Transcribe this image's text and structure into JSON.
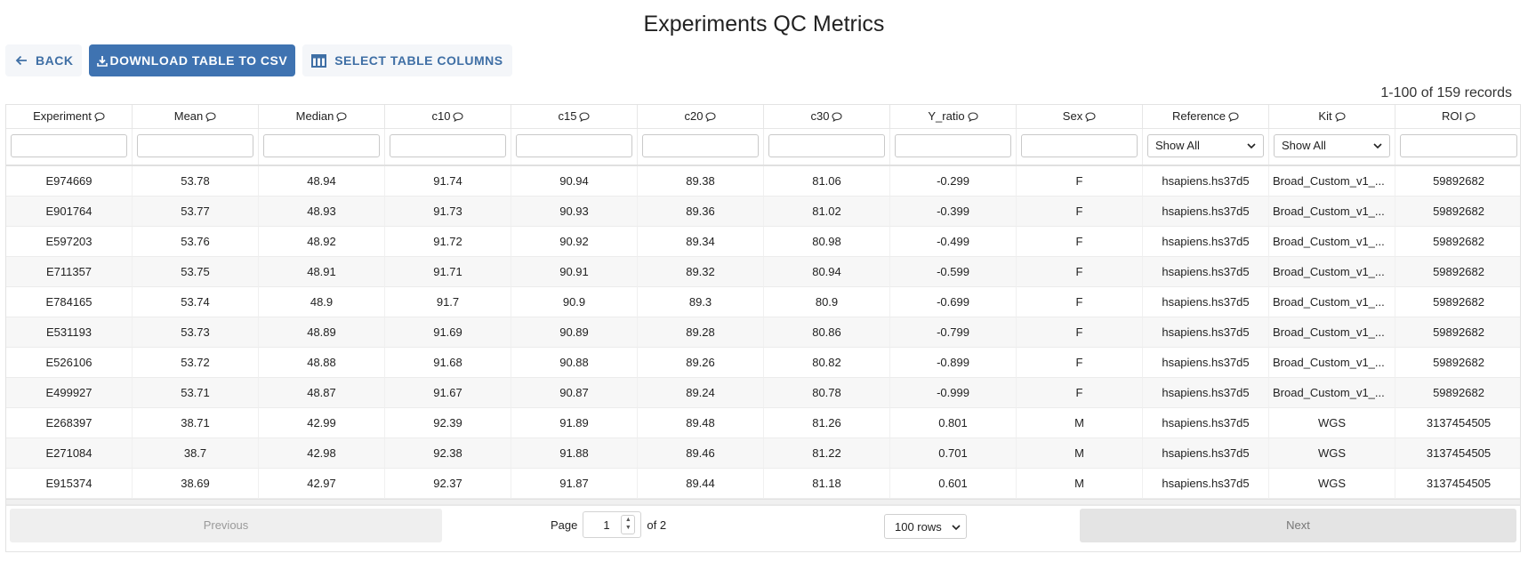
{
  "page": {
    "title": "Experiments QC Metrics"
  },
  "toolbar": {
    "back_label": "BACK",
    "download_label": "DOWNLOAD TABLE TO CSV",
    "columns_label": "SELECT TABLE COLUMNS"
  },
  "records_summary": "1-100 of 159 records",
  "table": {
    "headers": [
      "Experiment",
      "Mean",
      "Median",
      "c10",
      "c15",
      "c20",
      "c30",
      "Y_ratio",
      "Sex",
      "Reference",
      "Kit",
      "ROI"
    ],
    "filters": {
      "reference": "Show All",
      "kit": "Show All"
    },
    "rows": [
      [
        "E974669",
        "53.78",
        "48.94",
        "91.74",
        "90.94",
        "89.38",
        "81.06",
        "-0.299",
        "F",
        "hsapiens.hs37d5",
        "Broad_Custom_v1_...",
        "59892682"
      ],
      [
        "E901764",
        "53.77",
        "48.93",
        "91.73",
        "90.93",
        "89.36",
        "81.02",
        "-0.399",
        "F",
        "hsapiens.hs37d5",
        "Broad_Custom_v1_...",
        "59892682"
      ],
      [
        "E597203",
        "53.76",
        "48.92",
        "91.72",
        "90.92",
        "89.34",
        "80.98",
        "-0.499",
        "F",
        "hsapiens.hs37d5",
        "Broad_Custom_v1_...",
        "59892682"
      ],
      [
        "E711357",
        "53.75",
        "48.91",
        "91.71",
        "90.91",
        "89.32",
        "80.94",
        "-0.599",
        "F",
        "hsapiens.hs37d5",
        "Broad_Custom_v1_...",
        "59892682"
      ],
      [
        "E784165",
        "53.74",
        "48.9",
        "91.7",
        "90.9",
        "89.3",
        "80.9",
        "-0.699",
        "F",
        "hsapiens.hs37d5",
        "Broad_Custom_v1_...",
        "59892682"
      ],
      [
        "E531193",
        "53.73",
        "48.89",
        "91.69",
        "90.89",
        "89.28",
        "80.86",
        "-0.799",
        "F",
        "hsapiens.hs37d5",
        "Broad_Custom_v1_...",
        "59892682"
      ],
      [
        "E526106",
        "53.72",
        "48.88",
        "91.68",
        "90.88",
        "89.26",
        "80.82",
        "-0.899",
        "F",
        "hsapiens.hs37d5",
        "Broad_Custom_v1_...",
        "59892682"
      ],
      [
        "E499927",
        "53.71",
        "48.87",
        "91.67",
        "90.87",
        "89.24",
        "80.78",
        "-0.999",
        "F",
        "hsapiens.hs37d5",
        "Broad_Custom_v1_...",
        "59892682"
      ],
      [
        "E268397",
        "38.71",
        "42.99",
        "92.39",
        "91.89",
        "89.48",
        "81.26",
        "0.801",
        "M",
        "hsapiens.hs37d5",
        "WGS",
        "3137454505"
      ],
      [
        "E271084",
        "38.7",
        "42.98",
        "92.38",
        "91.88",
        "89.46",
        "81.22",
        "0.701",
        "M",
        "hsapiens.hs37d5",
        "WGS",
        "3137454505"
      ],
      [
        "E915374",
        "38.69",
        "42.97",
        "92.37",
        "91.87",
        "89.44",
        "81.18",
        "0.601",
        "M",
        "hsapiens.hs37d5",
        "WGS",
        "3137454505"
      ]
    ]
  },
  "pagination": {
    "previous_label": "Previous",
    "page_label": "Page",
    "current_page": "1",
    "of_label": "of 2",
    "rows_option": "100 rows",
    "next_label": "Next"
  },
  "colors": {
    "primary": "#3f73b1",
    "link": "#3f6fa5"
  }
}
